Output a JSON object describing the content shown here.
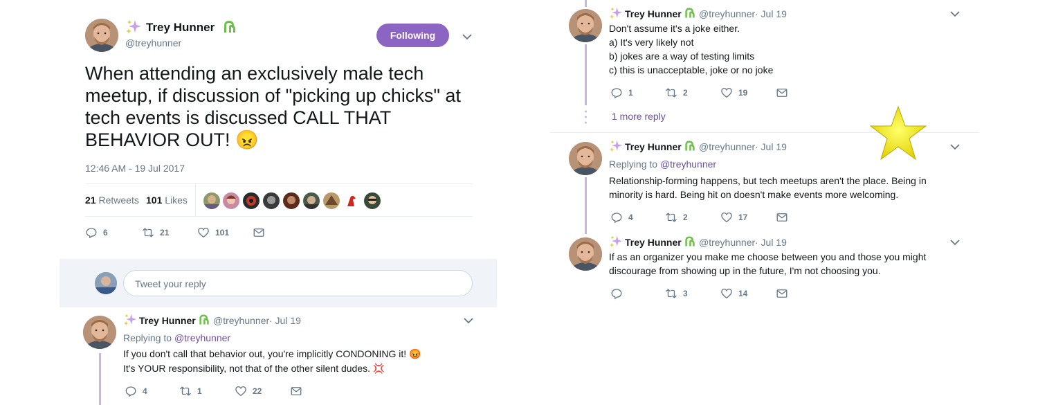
{
  "author": {
    "name": "Trey Hunner",
    "handle": "@treyhunner"
  },
  "main_tweet": {
    "follow_label": "Following",
    "text": "When attending an exclusively male tech meetup, if discussion of \"picking up chicks\" at tech events is discussed CALL THAT BEHAVIOR OUT! 😠",
    "timestamp": "12:46 AM - 19 Jul 2017",
    "retweets_count": "21",
    "retweets_label": "Retweets",
    "likes_count": "101",
    "likes_label": "Likes",
    "actions": {
      "replies": "6",
      "retweets": "21",
      "likes": "101"
    }
  },
  "reply_box": {
    "placeholder": "Tweet your reply"
  },
  "left_reply": {
    "date": "· Jul 19",
    "replying_to_label": "Replying to",
    "replying_to_handle": "@treyhunner",
    "line1": "If you don't call that behavior out, you're implicitly CONDONING it! 😡",
    "line2": "It's YOUR responsibility, not that of the other silent dudes. 💢",
    "actions": {
      "replies": "4",
      "retweets": "1",
      "likes": "22"
    }
  },
  "right_tweet_1": {
    "date": "· Jul 19",
    "lines": [
      "Don't assume it's a joke either.",
      "a) It's very likely not",
      "b) jokes are a way of testing limits",
      "c) this is unacceptable, joke or no joke"
    ],
    "actions": {
      "replies": "1",
      "retweets": "2",
      "likes": "19"
    },
    "more_reply": "1 more reply"
  },
  "right_tweet_2": {
    "date": "· Jul 19",
    "replying_to_label": "Replying to",
    "replying_to_handle": "@treyhunner",
    "line1": "Relationship-forming happens, but tech meetups aren't the place. Being in",
    "line2": "minority is hard. Being hit on doesn't make events more welcoming.",
    "actions": {
      "replies": "4",
      "retweets": "2",
      "likes": "17"
    }
  },
  "right_tweet_3": {
    "date": "· Jul 19",
    "line1": "If as an organizer you make me choose between you and those you might",
    "line2": "discourage from showing up in the future, I'm not choosing you.",
    "actions": {
      "replies": "",
      "retweets": "3",
      "likes": "14"
    }
  },
  "colors": {
    "accent": "#8c64c2",
    "link": "#6b4fa0",
    "thread_line": "#c7b6df",
    "star": "#f2e600"
  }
}
